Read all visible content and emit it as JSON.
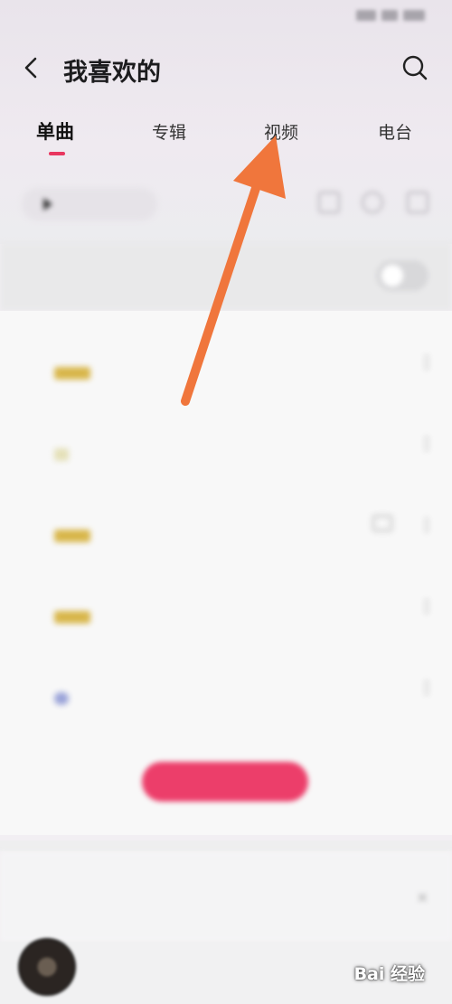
{
  "header": {
    "title": "我喜欢的"
  },
  "tabs": [
    {
      "label": "单曲",
      "active": true
    },
    {
      "label": "专辑",
      "active": false
    },
    {
      "label": "视频",
      "active": false
    },
    {
      "label": "电台",
      "active": false
    }
  ],
  "icons": {
    "back": "chevron-left-icon",
    "search": "search-icon",
    "play": "play-icon",
    "more": "more-vertical-icon",
    "video": "video-icon"
  },
  "colors": {
    "accent": "#e8365f",
    "annotation_arrow": "#f0763c"
  },
  "watermark": {
    "text": "Bai 经验"
  }
}
